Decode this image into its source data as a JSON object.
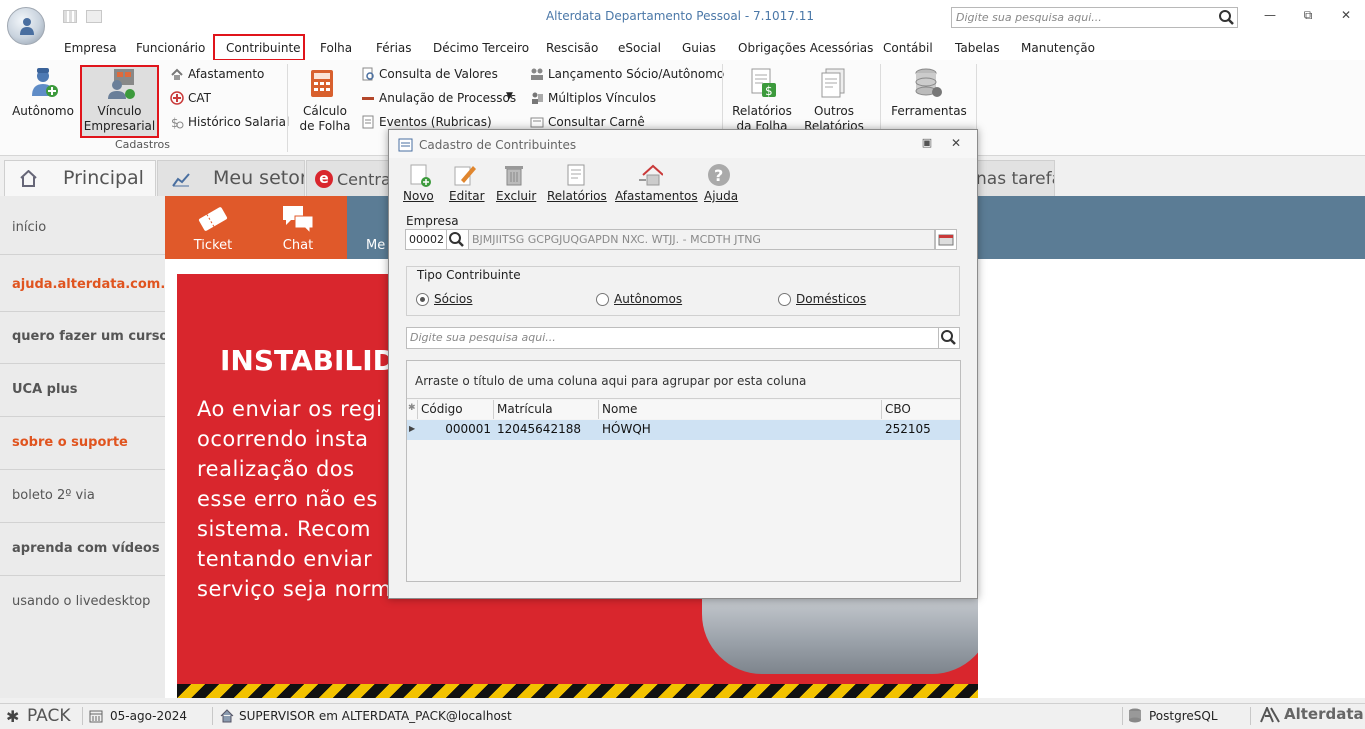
{
  "app": {
    "title": "Alterdata Departamento Pessoal - 7.1017.11",
    "search_placeholder": "Digite sua pesquisa aqui..."
  },
  "menu": [
    "Empresa",
    "Funcionário",
    "Contribuinte",
    "Folha",
    "Férias",
    "Décimo Terceiro",
    "Rescisão",
    "eSocial",
    "Guias",
    "Obrigações Acessórias",
    "Contábil",
    "Tabelas",
    "Manutenção"
  ],
  "ribbon": {
    "autonomo": "Autônomo",
    "vinculo_l1": "Vínculo",
    "vinculo_l2": "Empresarial",
    "afastamento": "Afastamento",
    "cat": "CAT",
    "historico": "Histórico Salarial",
    "group_cadastros": "Cadastros",
    "calculo_l1": "Cálculo",
    "calculo_l2": "de Folha",
    "consulta_valores": "Consulta de Valores",
    "anulacao": "Anulação de Processos",
    "eventos": "Eventos (Rubricas)",
    "lancamento": "Lançamento Sócio/Autônomo",
    "multiplos": "Múltiplos Vínculos",
    "consultar_carne": "Consultar Carnê",
    "relatorios_l1": "Relatórios",
    "relatorios_l2": "da Folha",
    "outros_l1": "Outros",
    "outros_l2": "Relatórios",
    "ferramentas": "Ferramentas"
  },
  "tabs": {
    "principal": "Principal",
    "meu_setor": "Meu setor",
    "central": "Central e",
    "tarefas": "nas tarefas"
  },
  "sidebar": [
    "início",
    "ajuda.alterdata.com.br",
    "quero fazer um curso",
    "UCA plus",
    "sobre o suporte",
    "boleto 2º via",
    "aprenda com vídeos",
    "usando o livedesktop"
  ],
  "content": {
    "ticket": "Ticket",
    "chat": "Chat",
    "me": "Me",
    "banner_title": "INSTABILID",
    "banner_lines": [
      "Ao enviar os regi",
      "ocorrendo  insta",
      "realização  dos",
      "esse erro não es",
      "sistema.  Recom",
      "tentando  enviar",
      "serviço seja norm"
    ]
  },
  "dialog": {
    "title": "Cadastro de Contribuintes",
    "toolbar": {
      "novo": "Novo",
      "editar": "Editar",
      "excluir": "Excluir",
      "relatorios": "Relatórios",
      "afastamentos": "Afastamentos",
      "ajuda": "Ajuda"
    },
    "empresa_label": "Empresa",
    "empresa_code": "00002",
    "empresa_name": "BJMJIITSG GCPGJUQGAPDN NXC. WTJJ. - MCDTH JTNG",
    "tipo_label": "Tipo Contribuinte",
    "tipos": [
      "Sócios",
      "Autônomos",
      "Domésticos"
    ],
    "search_placeholder": "Digite sua pesquisa aqui...",
    "group_hint": "Arraste o título de uma coluna aqui para agrupar por esta coluna",
    "columns": [
      "Código",
      "Matrícula",
      "Nome",
      "CBO"
    ],
    "rows": [
      {
        "codigo": "000001",
        "matricula": "12045642188",
        "nome": "HÓWQH",
        "cbo": "252105"
      }
    ]
  },
  "status": {
    "pack": "PACK",
    "date": "05-ago-2024",
    "user": "SUPERVISOR em ALTERDATA_PACK@localhost",
    "db": "PostgreSQL",
    "brand": "Alterdata"
  }
}
